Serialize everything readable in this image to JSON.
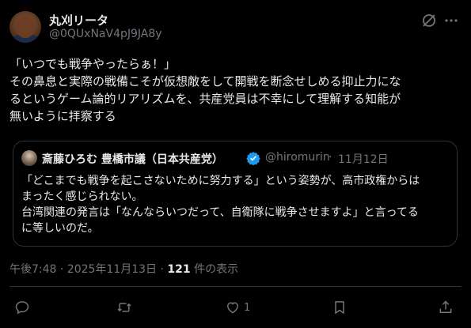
{
  "author": {
    "display_name": "丸刈リータ",
    "handle": "@0QUxNaV4pJ9JA8y"
  },
  "tweet": {
    "lines": [
      "「いつでも戦争やったらぁ！」",
      "その鼻息と実際の戦備こそが仮想敵をして開戦を断念せしめる抑止力にな",
      "るというゲーム論的リアリズムを、共産党員は不幸にして理解する知能が",
      "無いように拝察する"
    ]
  },
  "quote": {
    "display_name": "斎藤ひろむ 豊橋市議（日本共産党）",
    "handle": "@hiromurin",
    "separator": "·",
    "date": "11月12日",
    "lines": [
      "「どこまでも戦争を起こさないために努力する」という姿勢が、高市政権からは",
      "まったく感じられない。",
      "台湾関連の発言は「なんならいつだって、自衛隊に戦争させますよ」と言ってる",
      "に等しいのだ。"
    ]
  },
  "meta": {
    "timestamp": "午後7:48 · 2025年11月13日 · ",
    "views_count": "121",
    "views_label": " 件の表示"
  },
  "actions": {
    "like_count": "1"
  },
  "icons": {
    "grok": "grok-icon",
    "more": "more-icon",
    "verified": "verified-badge-icon",
    "reply": "reply-icon",
    "retweet": "retweet-icon",
    "like": "heart-icon",
    "bookmark": "bookmark-icon",
    "share": "share-icon"
  },
  "colors": {
    "background": "#000000",
    "text": "#e7e9ea",
    "secondary": "#71767b",
    "border": "#2f3336",
    "verified": "#1d9bf0"
  }
}
